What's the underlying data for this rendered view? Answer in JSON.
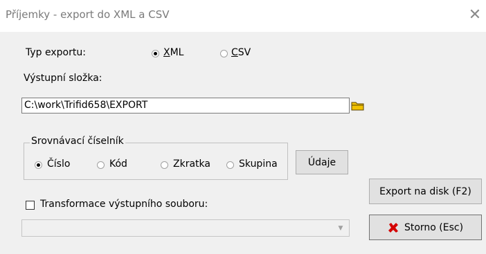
{
  "window": {
    "title": "Příjemky - export do XML a CSV",
    "close_glyph": "✕"
  },
  "export_type": {
    "label": "Typ exportu:",
    "options": [
      {
        "accel": "X",
        "rest": "ML",
        "selected": true
      },
      {
        "accel": "C",
        "rest": "SV",
        "selected": false
      }
    ]
  },
  "output_folder": {
    "label": "Výstupní složka:",
    "value": "C:\\work\\Trifid658\\EXPORT",
    "browse_icon": "folder-icon"
  },
  "comparison_codebook": {
    "legend": "Srovnávací číselník",
    "options": [
      {
        "label": "Číslo",
        "selected": true
      },
      {
        "label": "Kód",
        "selected": false
      },
      {
        "label": "Zkratka",
        "selected": false
      },
      {
        "label": "Skupina",
        "selected": false
      }
    ],
    "details_button": "Údaje"
  },
  "transform": {
    "label": "Transformace výstupního souboru:",
    "checked": false,
    "combo_value": ""
  },
  "buttons": {
    "export": "Export na disk (F2)",
    "cancel": "Storno (Esc)",
    "cancel_icon": "red-x-icon"
  },
  "colors": {
    "cancel_icon": "#d40000",
    "folder_icon": "#f2c200"
  }
}
